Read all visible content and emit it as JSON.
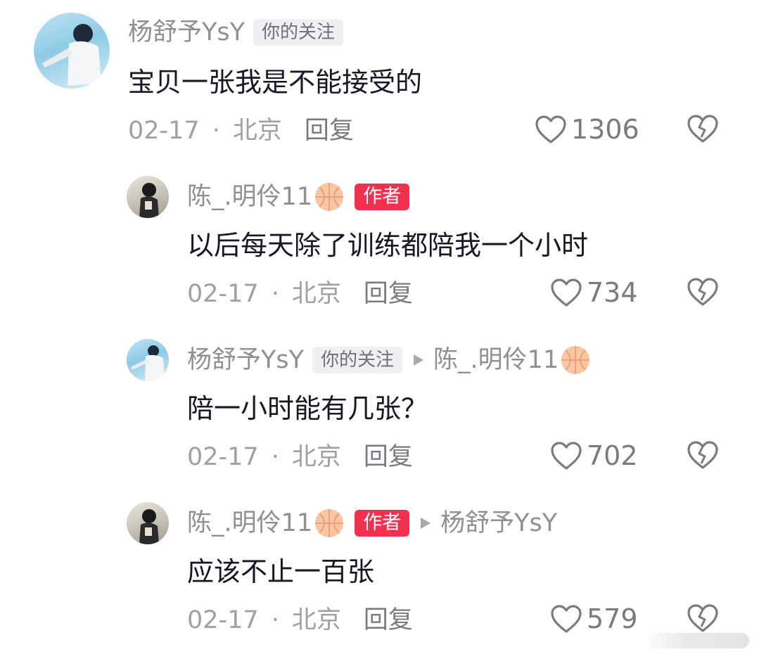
{
  "comments": [
    {
      "username": "杨舒予YsY",
      "tag": "你的关注",
      "text": "宝贝一张我是不能接受的",
      "date": "02-17",
      "separator": "·",
      "location": "北京",
      "reply_label": "回复",
      "likes": "1306"
    },
    {
      "username": "陈_.明伶11",
      "tag": "作者",
      "text": "以后每天除了训练都陪我一个小时",
      "date": "02-17",
      "separator": "·",
      "location": "北京",
      "reply_label": "回复",
      "likes": "734"
    },
    {
      "username": "杨舒予YsY",
      "tag": "你的关注",
      "reply_to": "陈_.明伶11",
      "text": "陪一小时能有几张？",
      "date": "02-17",
      "separator": "·",
      "location": "北京",
      "reply_label": "回复",
      "likes": "702"
    },
    {
      "username": "陈_.明伶11",
      "tag": "作者",
      "reply_to": "杨舒予YsY",
      "text": "应该不止一百张",
      "date": "02-17",
      "separator": "·",
      "location": "北京",
      "reply_label": "回复",
      "likes": "579"
    }
  ],
  "icons": {
    "like": "heart-outline-icon",
    "dislike": "broken-heart-icon",
    "basketball": "basketball-emoji-icon",
    "reply_arrow": "triangle-right-icon"
  },
  "colors": {
    "author_tag": "#f3304e",
    "follow_tag_bg": "#f0f0f2",
    "text": "#161823",
    "meta": "#a0a0a5"
  }
}
